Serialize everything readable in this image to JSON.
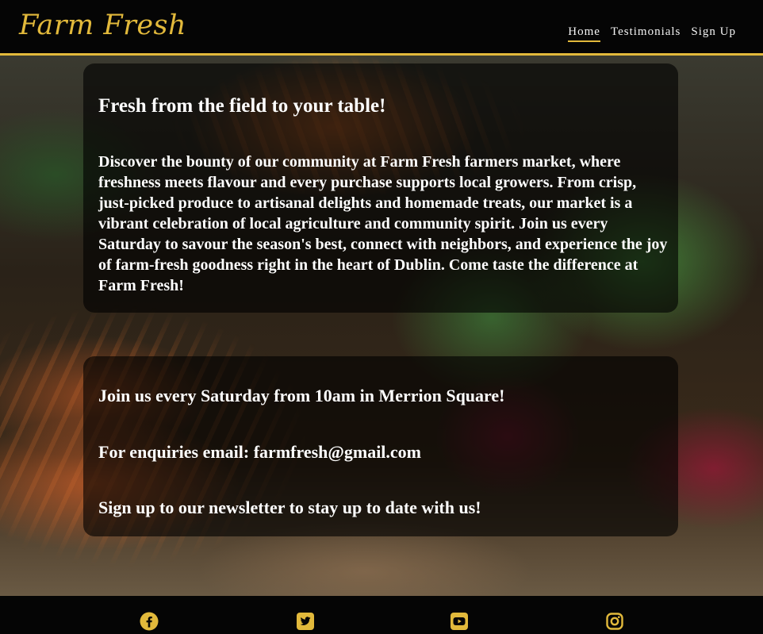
{
  "header": {
    "logo": "Farm Fresh",
    "nav": [
      {
        "label": "Home",
        "active": true
      },
      {
        "label": "Testimonials",
        "active": false
      },
      {
        "label": "Sign Up",
        "active": false
      }
    ]
  },
  "intro": {
    "title": "Fresh from the field to your table!",
    "text": "Discover the bounty of our community at Farm Fresh farmers market, where freshness meets flavour and every purchase supports local growers. From crisp, just-picked produce to artisanal delights and homemade treats, our market is a vibrant celebration of local agriculture and community spirit. Join us every Saturday to savour the season's best, connect with neighbors, and experience the joy of farm-fresh goodness right in the heart of Dublin. Come taste the difference at Farm Fresh!"
  },
  "info": {
    "line1": "Join us every Saturday from 10am in Merrion Square!",
    "line2": "For enquiries email: farmfresh@gmail.com",
    "line3": "Sign up to our newsletter to stay up to date with us!"
  },
  "footer": {
    "social_icons": [
      "facebook-icon",
      "twitter-icon",
      "youtube-icon",
      "instagram-icon"
    ]
  },
  "colors": {
    "accent": "#e2b93b",
    "header_bg": "#050505",
    "text": "#ffffff"
  }
}
